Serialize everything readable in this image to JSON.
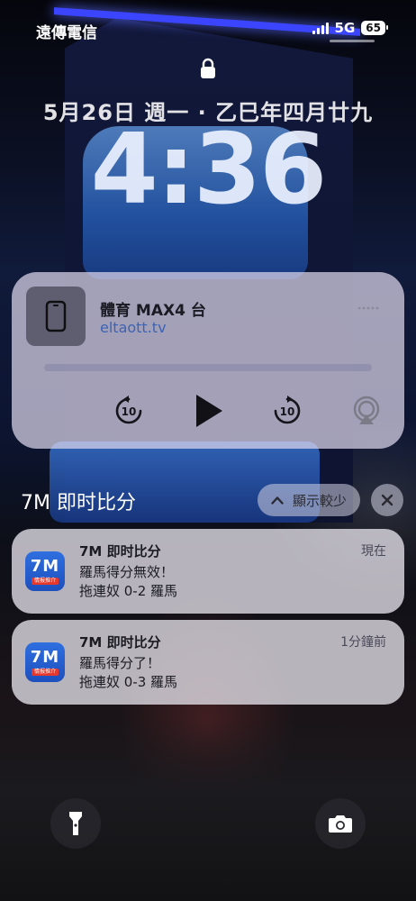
{
  "status_bar": {
    "carrier": "遠傳電信",
    "network": "5G",
    "battery": "65"
  },
  "lock_screen": {
    "date": "5月26日 週一 · 乙巳年四月廿九",
    "time": "4:36"
  },
  "now_playing": {
    "title": "體育 MAX4 台",
    "source": "eltaott.tv",
    "progress": 0.0,
    "controls": [
      "skip-back-10-icon",
      "play-icon",
      "skip-forward-10-icon",
      "airplay-icon"
    ],
    "skip_seconds": "10"
  },
  "notification_group": {
    "app_name": "7M 即时比分",
    "show_less_label": "顯示較少"
  },
  "notifications": [
    {
      "app": "7M 即时比分",
      "time": "現在",
      "title": "羅馬得分無效！",
      "body": "拖連奴 0-2 羅馬",
      "icon_mark": "7M",
      "icon_tag": "情报推介"
    },
    {
      "app": "7M 即时比分",
      "time": "1分鐘前",
      "title": "羅馬得分了！",
      "body": "拖連奴 0-3 羅馬",
      "icon_mark": "7M",
      "icon_tag": "情报推介"
    }
  ],
  "bottom_actions": [
    "flashlight-icon",
    "camera-icon"
  ],
  "colors": {
    "accent_link": "#3d63b3",
    "app_icon_blue": "#2f6fe0",
    "app_icon_tag": "#e8372b"
  }
}
